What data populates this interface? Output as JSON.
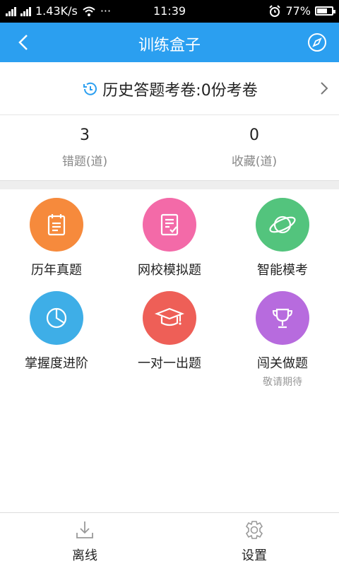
{
  "status_bar": {
    "network_speed": "1.43K/s",
    "dots": "···",
    "time": "11:39",
    "battery": "77%",
    "battery_level": 0.77
  },
  "header": {
    "title": "训练盒子",
    "back_icon": "chevron-left-icon",
    "right_icon": "compass-icon"
  },
  "history": {
    "text": "历史答题考卷:0份考卷",
    "icon": "history-clock-icon"
  },
  "stats": [
    {
      "value": "3",
      "label": "错题(道)"
    },
    {
      "value": "0",
      "label": "收藏(道)"
    }
  ],
  "grid": {
    "items": [
      {
        "label": "历年真题",
        "color": "#f68a3c",
        "icon": "calendar-icon"
      },
      {
        "label": "网校模拟题",
        "color": "#f36aa8",
        "icon": "exam-paper-icon"
      },
      {
        "label": "智能模考",
        "color": "#53c47d",
        "icon": "planet-icon"
      },
      {
        "label": "掌握度进阶",
        "color": "#3eaee7",
        "icon": "pie-chart-icon"
      },
      {
        "label": "一对一出题",
        "color": "#ee5f57",
        "icon": "graduation-cap-icon"
      },
      {
        "label": "闯关做题",
        "sublabel": "敬请期待",
        "color": "#b76bde",
        "icon": "trophy-icon"
      }
    ]
  },
  "bottom_nav": [
    {
      "label": "离线",
      "icon": "download-icon"
    },
    {
      "label": "设置",
      "icon": "gear-icon"
    }
  ],
  "colors": {
    "primary": "#2b9ff0"
  }
}
